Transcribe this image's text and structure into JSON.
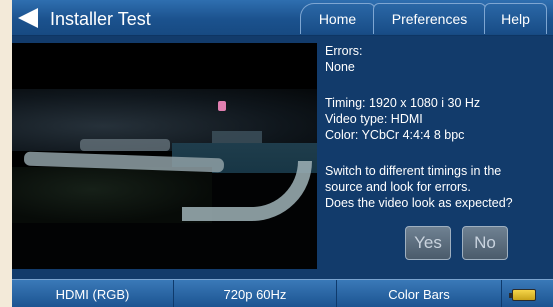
{
  "header": {
    "title": "Installer Test",
    "tabs": [
      {
        "label": "Home"
      },
      {
        "label": "Preferences"
      },
      {
        "label": "Help"
      }
    ]
  },
  "info": {
    "errors_label": "Errors:",
    "errors_value": "None",
    "timing": "Timing: 1920 x 1080 i 30 Hz",
    "video_type": "Video type: HDMI",
    "color": "Color: YCbCr 4:4:4 8 bpc",
    "prompt_lines": [
      "Switch to different timings in the",
      "source and look for errors.",
      "Does the video look as expected?"
    ]
  },
  "buttons": {
    "yes_label": "Yes",
    "no_label": "No"
  },
  "status_bar": {
    "items": [
      {
        "label": "HDMI (RGB)"
      },
      {
        "label": "720p 60Hz"
      },
      {
        "label": "Color Bars"
      }
    ],
    "battery_icon": "battery-icon"
  },
  "colors": {
    "background": "#123b6b",
    "bar": "#1c5491",
    "battery": "#f6d64a"
  }
}
